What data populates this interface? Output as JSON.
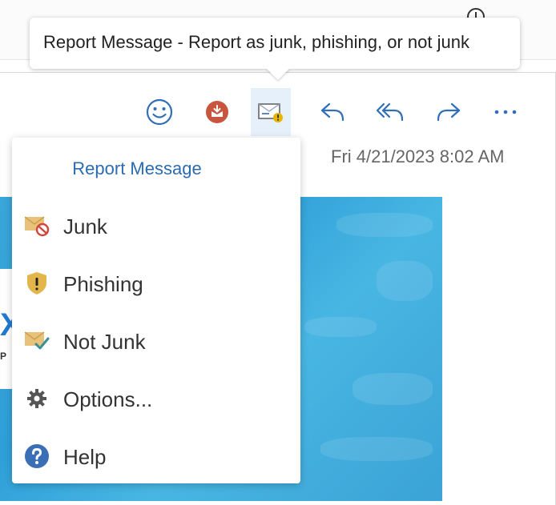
{
  "tooltip": {
    "text": "Report Message - Report as junk, phishing, or not junk"
  },
  "toolbar": {
    "buttons": [
      {
        "name": "emoji-react",
        "icon": "smiley-icon"
      },
      {
        "name": "report-phishing",
        "icon": "report-envelope-icon"
      },
      {
        "name": "report-message",
        "icon": "message-warning-icon",
        "active": true
      },
      {
        "name": "reply",
        "icon": "reply-arrow-icon"
      },
      {
        "name": "reply-all",
        "icon": "reply-all-arrow-icon"
      },
      {
        "name": "forward",
        "icon": "forward-arrow-icon"
      },
      {
        "name": "more-actions",
        "icon": "ellipsis-icon"
      }
    ]
  },
  "message": {
    "date": "Fri 4/21/2023 8:02 AM"
  },
  "menu": {
    "title": "Report Message",
    "items": [
      {
        "label": "Junk",
        "icon": "junk-envelope-icon"
      },
      {
        "label": "Phishing",
        "icon": "phishing-shield-icon"
      },
      {
        "label": "Not Junk",
        "icon": "not-junk-envelope-icon"
      },
      {
        "label": "Options...",
        "icon": "gear-icon"
      },
      {
        "label": "Help",
        "icon": "help-icon"
      }
    ]
  },
  "colors": {
    "accent_blue": "#2b6cb0",
    "toolbar_icon_blue": "#2f6fb8",
    "active_button_bg": "#e6f0fb",
    "report_red": "#c8553d",
    "image_blue": "#3aa5d8"
  }
}
